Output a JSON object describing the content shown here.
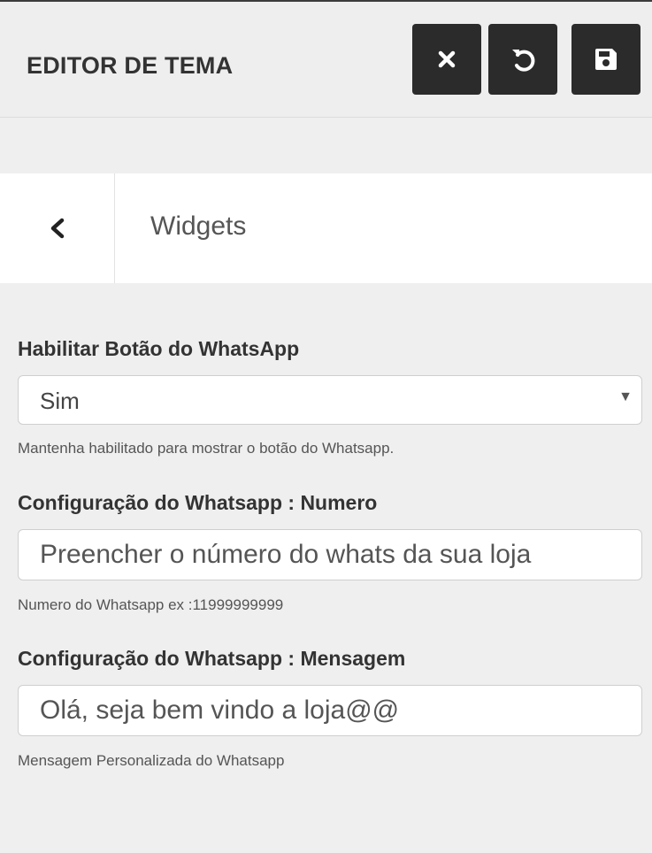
{
  "header": {
    "title": "EDITOR DE TEMA",
    "buttons": [
      {
        "name": "close",
        "icon": "close-icon"
      },
      {
        "name": "reset",
        "icon": "undo-icon"
      },
      {
        "name": "save",
        "icon": "save-icon"
      }
    ]
  },
  "panel": {
    "back_icon": "chevron-left-icon",
    "title": "Widgets"
  },
  "fields": {
    "whatsapp_enable": {
      "label": "Habilitar Botão do WhatsApp",
      "value": "Sim",
      "help": "Mantenha habilitado para mostrar o botão do Whatsapp."
    },
    "whatsapp_number": {
      "label": "Configuração do Whatsapp : Numero",
      "value": "Preencher o número do whats da sua loja",
      "help": "Numero do Whatsapp ex :11999999999"
    },
    "whatsapp_message": {
      "label": "Configuração do Whatsapp : Mensagem",
      "value": "Olá, seja bem vindo a loja@@",
      "help": "Mensagem Personalizada do Whatsapp"
    }
  },
  "colors": {
    "background": "#efefef",
    "header_button": "#2b2b2b",
    "panel": "#ffffff"
  }
}
